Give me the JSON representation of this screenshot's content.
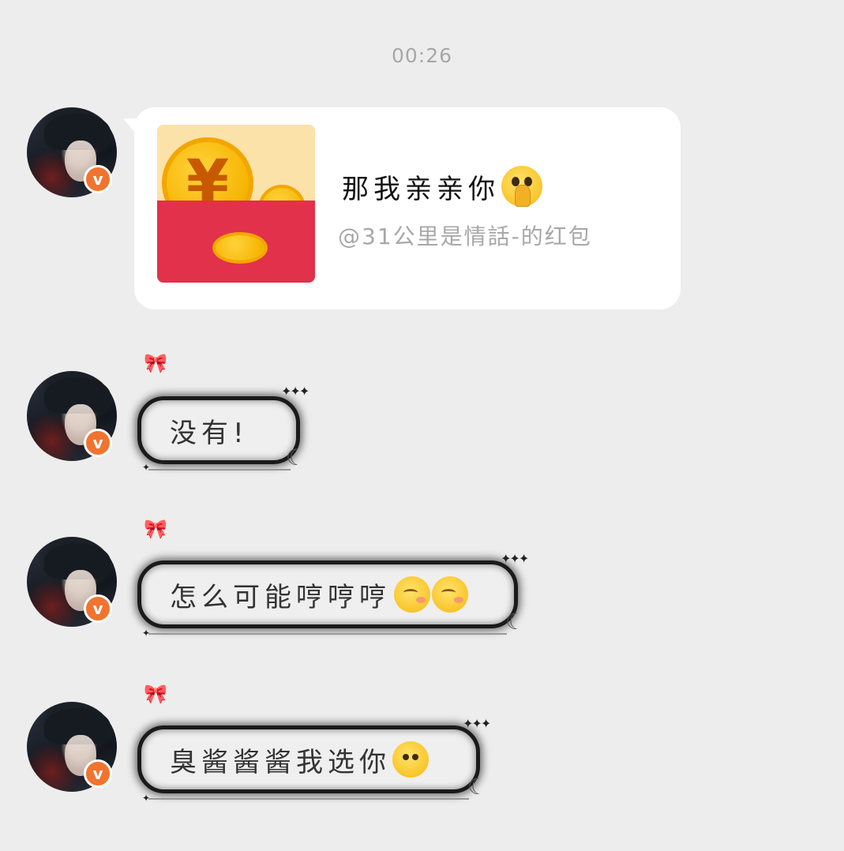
{
  "timestamp": "00:26",
  "messages": [
    {
      "type": "red_packet",
      "avatar_badge": "v",
      "title": "那我亲亲你",
      "title_emoji": "pleading-hands-emoji",
      "subtitle": "@31公里是情話-的红包",
      "icon": "red-packet-icon",
      "yuan_symbol": "¥"
    },
    {
      "type": "text",
      "avatar_badge": "v",
      "text": "没有!",
      "emojis": []
    },
    {
      "type": "text",
      "avatar_badge": "v",
      "text": "怎么可能哼哼哼",
      "emojis": [
        "huff-emoji",
        "huff-emoji"
      ]
    },
    {
      "type": "text",
      "avatar_badge": "v",
      "text": "臭酱酱酱我选你",
      "emojis": [
        "cover-face-emoji"
      ]
    }
  ],
  "colors": {
    "background": "#ededed",
    "badge": "#f0742f",
    "red_packet": "#e2314a",
    "coin": "#f6b400"
  }
}
